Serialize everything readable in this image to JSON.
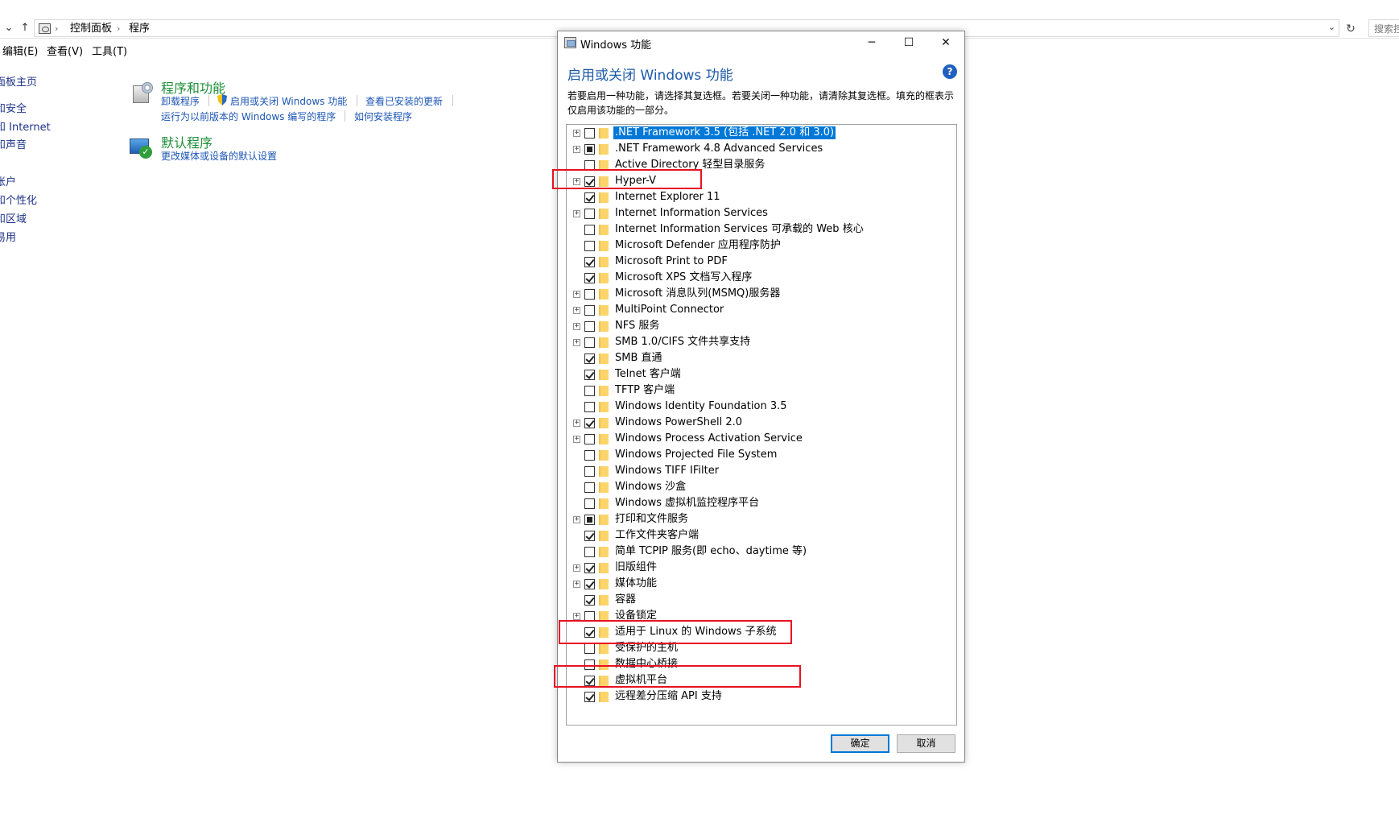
{
  "explorer": {
    "breadcrumb": [
      "控制面板",
      "程序"
    ],
    "search_placeholder": "搜索控",
    "menu": [
      "编辑(E)",
      "查看(V)",
      "工具(T)"
    ],
    "leftnav": [
      "面板主页",
      "和安全",
      "和 Internet",
      "和声音",
      "帐户",
      "和个性化",
      "和区域",
      "易用"
    ],
    "categories": {
      "programs": {
        "title": "程序和功能",
        "links": [
          "卸载程序",
          "启用或关闭 Windows 功能",
          "查看已安装的更新",
          "运行为以前版本的 Windows 编写的程序",
          "如何安装程序"
        ]
      },
      "defaults": {
        "title": "默认程序",
        "links": [
          "更改媒体或设备的默认设置"
        ]
      }
    }
  },
  "dialog": {
    "title": "Windows 功能",
    "header": "启用或关闭 Windows 功能",
    "help_icon": "?",
    "description": "若要启用一种功能，请选择其复选框。若要关闭一种功能，请清除其复选框。填充的框表示仅启用该功能的一部分。",
    "features": [
      {
        "label": ".NET Framework 3.5 (包括 .NET 2.0 和 3.0)",
        "state": "unchecked",
        "expandable": true,
        "selected": true
      },
      {
        "label": ".NET Framework 4.8 Advanced Services",
        "state": "partial",
        "expandable": true
      },
      {
        "label": "Active Directory 轻型目录服务",
        "state": "unchecked",
        "expandable": false
      },
      {
        "label": "Hyper-V",
        "state": "checked",
        "expandable": true
      },
      {
        "label": "Internet Explorer 11",
        "state": "checked",
        "expandable": false
      },
      {
        "label": "Internet Information Services",
        "state": "unchecked",
        "expandable": true
      },
      {
        "label": "Internet Information Services 可承载的 Web 核心",
        "state": "unchecked",
        "expandable": false
      },
      {
        "label": "Microsoft Defender 应用程序防护",
        "state": "unchecked",
        "expandable": false
      },
      {
        "label": "Microsoft Print to PDF",
        "state": "checked",
        "expandable": false
      },
      {
        "label": "Microsoft XPS 文档写入程序",
        "state": "checked",
        "expandable": false
      },
      {
        "label": "Microsoft 消息队列(MSMQ)服务器",
        "state": "unchecked",
        "expandable": true
      },
      {
        "label": "MultiPoint Connector",
        "state": "unchecked",
        "expandable": true
      },
      {
        "label": "NFS 服务",
        "state": "unchecked",
        "expandable": true
      },
      {
        "label": "SMB 1.0/CIFS 文件共享支持",
        "state": "unchecked",
        "expandable": true
      },
      {
        "label": "SMB 直通",
        "state": "checked",
        "expandable": false
      },
      {
        "label": "Telnet 客户端",
        "state": "checked",
        "expandable": false
      },
      {
        "label": "TFTP 客户端",
        "state": "unchecked",
        "expandable": false
      },
      {
        "label": "Windows Identity Foundation 3.5",
        "state": "unchecked",
        "expandable": false
      },
      {
        "label": "Windows PowerShell 2.0",
        "state": "checked",
        "expandable": true
      },
      {
        "label": "Windows Process Activation Service",
        "state": "unchecked",
        "expandable": true
      },
      {
        "label": "Windows Projected File System",
        "state": "unchecked",
        "expandable": false
      },
      {
        "label": "Windows TIFF IFilter",
        "state": "unchecked",
        "expandable": false
      },
      {
        "label": "Windows 沙盒",
        "state": "unchecked",
        "expandable": false
      },
      {
        "label": "Windows 虚拟机监控程序平台",
        "state": "unchecked",
        "expandable": false
      },
      {
        "label": "打印和文件服务",
        "state": "partial",
        "expandable": true
      },
      {
        "label": "工作文件夹客户端",
        "state": "checked",
        "expandable": false
      },
      {
        "label": "简单 TCPIP 服务(即 echo、daytime 等)",
        "state": "unchecked",
        "expandable": false
      },
      {
        "label": "旧版组件",
        "state": "checked",
        "expandable": true
      },
      {
        "label": "媒体功能",
        "state": "checked",
        "expandable": true
      },
      {
        "label": "容器",
        "state": "checked",
        "expandable": false
      },
      {
        "label": "设备锁定",
        "state": "unchecked",
        "expandable": true
      },
      {
        "label": "适用于 Linux 的 Windows 子系统",
        "state": "checked",
        "expandable": false
      },
      {
        "label": "受保护的主机",
        "state": "unchecked",
        "expandable": false
      },
      {
        "label": "数据中心桥接",
        "state": "unchecked",
        "expandable": false
      },
      {
        "label": "虚拟机平台",
        "state": "checked",
        "expandable": false
      },
      {
        "label": "远程差分压缩 API 支持",
        "state": "checked",
        "expandable": false
      }
    ],
    "ok_label": "确定",
    "cancel_label": "取消"
  },
  "colors": {
    "accent": "#0078d7",
    "link": "#1b55b3",
    "category_title": "#1e8f3a",
    "highlight": "#e81123"
  }
}
